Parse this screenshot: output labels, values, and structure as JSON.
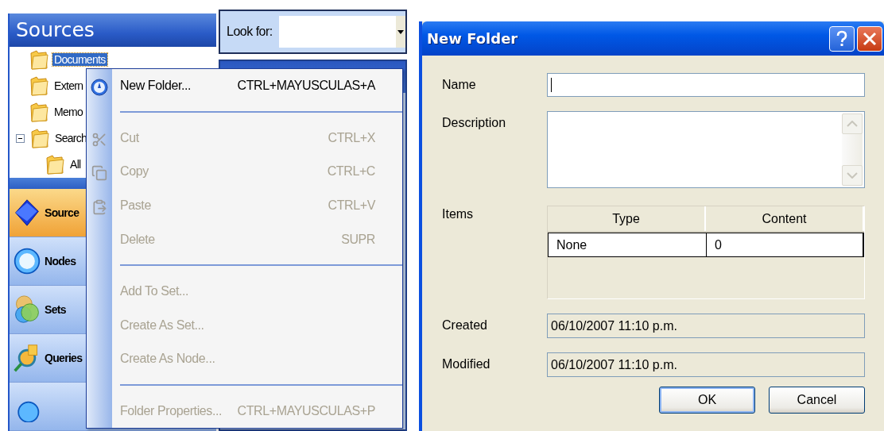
{
  "sources_panel": {
    "title": "Sources",
    "tree": [
      {
        "label": "Documents",
        "selected": true
      },
      {
        "label": "Extern",
        "selected": false
      },
      {
        "label": "Memo",
        "selected": false
      },
      {
        "label": "Search",
        "selected": false,
        "expanded": true,
        "children": [
          {
            "label": "All",
            "selected": false
          }
        ]
      }
    ],
    "nav": [
      {
        "label": "Source",
        "selected": true
      },
      {
        "label": "Nodes",
        "selected": false
      },
      {
        "label": "Sets",
        "selected": false
      },
      {
        "label": "Queries",
        "selected": false
      },
      {
        "selected": false
      }
    ]
  },
  "search_bar": {
    "label": "Look for:"
  },
  "context_menu": {
    "items": [
      {
        "kind": "item",
        "label": "New Folder...",
        "shortcut": "CTRL+MAYUSCULAS+A",
        "disabled": false
      },
      {
        "kind": "separator"
      },
      {
        "kind": "item",
        "label": "Cut",
        "shortcut": "CTRL+X",
        "disabled": true
      },
      {
        "kind": "item",
        "label": "Copy",
        "shortcut": "CTRL+C",
        "disabled": true
      },
      {
        "kind": "item",
        "label": "Paste",
        "shortcut": "CTRL+V",
        "disabled": true
      },
      {
        "kind": "item",
        "label": "Delete",
        "shortcut": "SUPR",
        "disabled": true
      },
      {
        "kind": "separator"
      },
      {
        "kind": "item",
        "label": "Add To Set...",
        "disabled": true
      },
      {
        "kind": "item",
        "label": "Create As Set...",
        "disabled": true
      },
      {
        "kind": "item",
        "label": "Create As Node...",
        "disabled": true
      },
      {
        "kind": "separator"
      },
      {
        "kind": "item",
        "label": "Folder Properties...",
        "shortcut": "CTRL+MAYUSCULAS+P",
        "disabled": true
      }
    ]
  },
  "dialog": {
    "title": "New Folder",
    "fields": [
      {
        "kind": "text",
        "label": "Name"
      },
      {
        "kind": "memo",
        "label": "Description"
      },
      {
        "kind": "table",
        "label": "Items",
        "columns": [
          "Type",
          "Content"
        ],
        "rows": [
          [
            "None",
            "0"
          ]
        ]
      },
      {
        "kind": "readonly",
        "label": "Created",
        "value": "06/10/2007 11:10 p.m."
      },
      {
        "kind": "readonly",
        "label": "Modified",
        "value": "06/10/2007 11:10 p.m."
      }
    ],
    "buttons": [
      {
        "label": "OK",
        "default": true
      },
      {
        "label": "Cancel",
        "default": false
      }
    ]
  }
}
